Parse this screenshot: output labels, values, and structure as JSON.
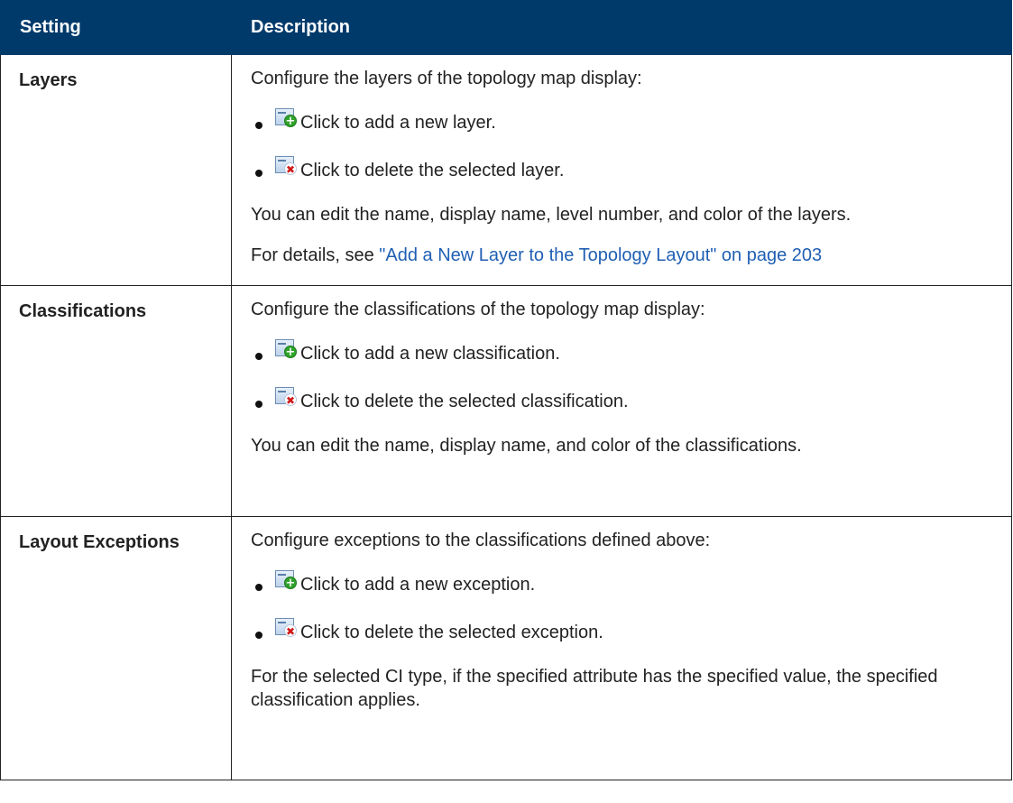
{
  "header": {
    "setting": "Setting",
    "description": "Description"
  },
  "rows": [
    {
      "setting": "Layers",
      "intro": "Configure the layers of the topology map display:",
      "add_text": "Click to add a new layer.",
      "delete_text": "Click to delete the selected layer.",
      "note": "You can edit the name, display name, level number, and color of the layers.",
      "details_prefix": "For details, see ",
      "details_link": "\"Add a New Layer to the Topology Layout\" on page 203"
    },
    {
      "setting": "Classifications",
      "intro": "Configure the classifications of the topology map display:",
      "add_text": "Click to add a new classification.",
      "delete_text": "Click to delete the selected classification.",
      "note": "You can edit the name, display name, and color of the classifications."
    },
    {
      "setting": "Layout Exceptions",
      "intro": "Configure exceptions to the classifications defined above:",
      "add_text": "Click to add a new exception.",
      "delete_text": "Click to delete the selected exception.",
      "note": "For the selected CI type, if the specified attribute has the specified value, the specified classification applies."
    }
  ],
  "icons": {
    "add": "add-item-icon",
    "delete": "delete-item-icon"
  },
  "colors": {
    "header_bg": "#003a6b",
    "link": "#1f5fb3"
  }
}
